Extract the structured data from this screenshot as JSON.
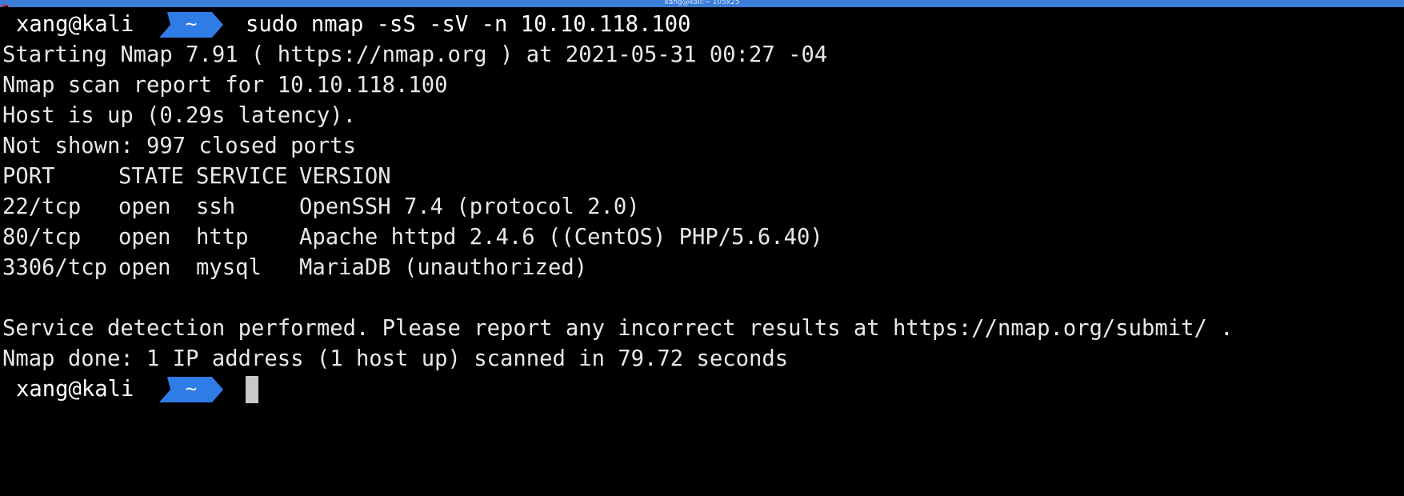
{
  "window": {
    "title": "xang@kali:~ 105x25",
    "accent_color": "#3b7dd8",
    "prompt_segment_color": "#2f7ce6",
    "icon": "terminal-icon"
  },
  "prompt": {
    "user_host": "xang@kali",
    "directory": "~"
  },
  "command": "sudo nmap -sS -sV -n 10.10.118.100",
  "output": {
    "starting": "Starting Nmap 7.91 ( https://nmap.org ) at 2021-05-31 00:27 -04",
    "report": "Nmap scan report for 10.10.118.100",
    "host_up": "Host is up (0.29s latency).",
    "not_shown": "Not shown: 997 closed ports",
    "table": {
      "headers": [
        "PORT",
        "STATE",
        "SERVICE",
        "VERSION"
      ],
      "rows": [
        [
          "22/tcp",
          "open",
          "ssh",
          "OpenSSH 7.4 (protocol 2.0)"
        ],
        [
          "80/tcp",
          "open",
          "http",
          "Apache httpd 2.4.6 ((CentOS) PHP/5.6.40)"
        ],
        [
          "3306/tcp",
          "open",
          "mysql",
          "MariaDB (unauthorized)"
        ]
      ]
    },
    "service_detection": "Service detection performed. Please report any incorrect results at https://nmap.org/submit/ .",
    "done": "Nmap done: 1 IP address (1 host up) scanned in 79.72 seconds"
  }
}
